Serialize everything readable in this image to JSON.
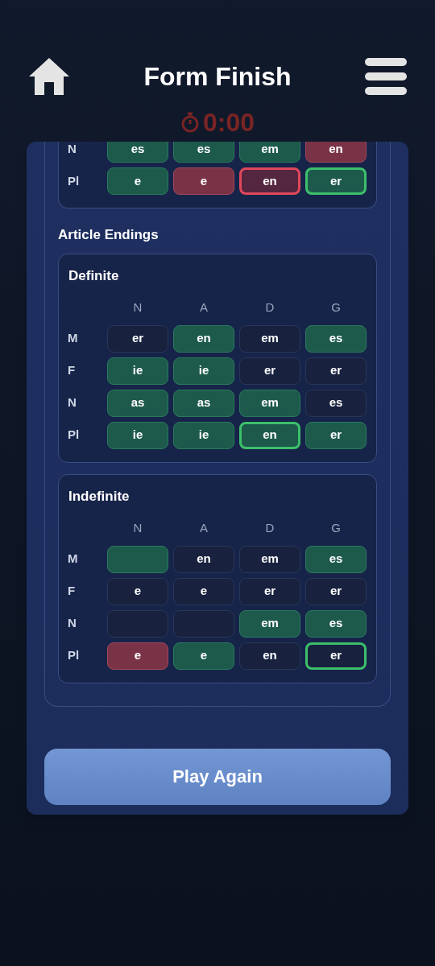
{
  "header": {
    "title": "Form Finish",
    "timer": "0:00"
  },
  "top_table": {
    "rows": [
      {
        "label": "N",
        "cells": [
          {
            "text": "es",
            "kind": "correct",
            "outlined": false
          },
          {
            "text": "es",
            "kind": "correct",
            "outlined": false
          },
          {
            "text": "em",
            "kind": "correct",
            "outlined": false
          },
          {
            "text": "en",
            "kind": "wrong",
            "outlined": false
          }
        ]
      },
      {
        "label": "Pl",
        "cells": [
          {
            "text": "e",
            "kind": "correct",
            "outlined": false
          },
          {
            "text": "e",
            "kind": "wrong",
            "outlined": false
          },
          {
            "text": "en",
            "kind": "wrong",
            "outlined": true
          },
          {
            "text": "er",
            "kind": "correct",
            "outlined": true
          }
        ]
      }
    ]
  },
  "section_title": "Article Endings",
  "tables": [
    {
      "title": "Definite",
      "columns": [
        "N",
        "A",
        "D",
        "G"
      ],
      "rows": [
        {
          "label": "M",
          "cells": [
            {
              "text": "er",
              "kind": "blank",
              "outlined": false
            },
            {
              "text": "en",
              "kind": "correct",
              "outlined": false
            },
            {
              "text": "em",
              "kind": "blank",
              "outlined": false
            },
            {
              "text": "es",
              "kind": "correct",
              "outlined": false
            }
          ]
        },
        {
          "label": "F",
          "cells": [
            {
              "text": "ie",
              "kind": "correct",
              "outlined": false
            },
            {
              "text": "ie",
              "kind": "correct",
              "outlined": false
            },
            {
              "text": "er",
              "kind": "blank",
              "outlined": false
            },
            {
              "text": "er",
              "kind": "blank",
              "outlined": false
            }
          ]
        },
        {
          "label": "N",
          "cells": [
            {
              "text": "as",
              "kind": "correct",
              "outlined": false
            },
            {
              "text": "as",
              "kind": "correct",
              "outlined": false
            },
            {
              "text": "em",
              "kind": "correct",
              "outlined": false
            },
            {
              "text": "es",
              "kind": "blank",
              "outlined": false
            }
          ]
        },
        {
          "label": "Pl",
          "cells": [
            {
              "text": "ie",
              "kind": "correct",
              "outlined": false
            },
            {
              "text": "ie",
              "kind": "correct",
              "outlined": false
            },
            {
              "text": "en",
              "kind": "correct",
              "outlined": true
            },
            {
              "text": "er",
              "kind": "correct",
              "outlined": false
            }
          ]
        }
      ]
    },
    {
      "title": "Indefinite",
      "columns": [
        "N",
        "A",
        "D",
        "G"
      ],
      "rows": [
        {
          "label": "M",
          "cells": [
            {
              "kind": "correct",
              "outlined": false
            },
            {
              "text": "en",
              "kind": "blank",
              "outlined": false
            },
            {
              "text": "em",
              "kind": "blank",
              "outlined": false
            },
            {
              "text": "es",
              "kind": "correct",
              "outlined": false
            }
          ]
        },
        {
          "label": "F",
          "cells": [
            {
              "text": "e",
              "kind": "blank",
              "outlined": false
            },
            {
              "text": "e",
              "kind": "blank",
              "outlined": false
            },
            {
              "text": "er",
              "kind": "blank",
              "outlined": false
            },
            {
              "text": "er",
              "kind": "blank",
              "outlined": false
            }
          ]
        },
        {
          "label": "N",
          "cells": [
            {
              "kind": "blank",
              "outlined": false
            },
            {
              "kind": "blank",
              "outlined": false
            },
            {
              "text": "em",
              "kind": "correct",
              "outlined": false
            },
            {
              "text": "es",
              "kind": "correct",
              "outlined": false
            }
          ]
        },
        {
          "label": "Pl",
          "cells": [
            {
              "text": "e",
              "kind": "wrong",
              "outlined": false
            },
            {
              "text": "e",
              "kind": "correct",
              "outlined": false
            },
            {
              "text": "en",
              "kind": "blank",
              "outlined": false
            },
            {
              "text": "er",
              "kind": "blank",
              "outlined": true
            }
          ]
        }
      ]
    }
  ],
  "button": "Play Again"
}
